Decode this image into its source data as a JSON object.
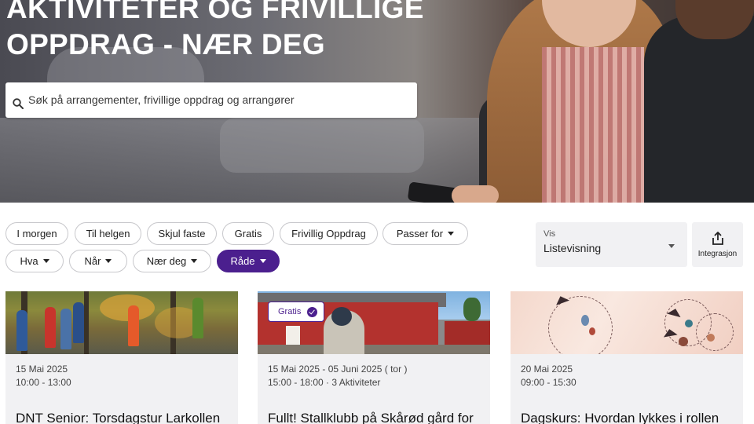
{
  "hero": {
    "title_line1": "AKTIVITETER OG FRIVILLIGE",
    "title_line2": "OPPDRAG - NÆR DEG"
  },
  "search": {
    "placeholder": "Søk på arrangementer, frivillige oppdrag og arrangører",
    "icon": "search-icon"
  },
  "filters": [
    {
      "label": "I morgen",
      "dropdown": false,
      "active": false
    },
    {
      "label": "Til helgen",
      "dropdown": false,
      "active": false
    },
    {
      "label": "Skjul faste",
      "dropdown": false,
      "active": false
    },
    {
      "label": "Gratis",
      "dropdown": false,
      "active": false
    },
    {
      "label": "Frivillig Oppdrag",
      "dropdown": false,
      "active": false
    },
    {
      "label": "Passer for",
      "dropdown": true,
      "active": false
    },
    {
      "label": "Hva",
      "dropdown": true,
      "active": false
    },
    {
      "label": "Når",
      "dropdown": true,
      "active": false
    },
    {
      "label": "Nær deg",
      "dropdown": true,
      "active": false
    },
    {
      "label": "Råde",
      "dropdown": true,
      "active": true
    }
  ],
  "view": {
    "label": "Vis",
    "value": "Listevisning"
  },
  "integration": {
    "label": "Integrasjon",
    "icon": "share-icon"
  },
  "colors": {
    "accent": "#4b1f8e",
    "card_bg": "#f1f1f3"
  },
  "cards": [
    {
      "date": "15 Mai 2025",
      "time": "10:00 - 13:00",
      "title": "DNT Senior: Torsdagstur Larkollen"
    },
    {
      "badge": "Gratis",
      "date": "15 Mai 2025 - 05 Juni 2025 ( tor )",
      "time": "15:00 - 18:00 · 3 Aktiviteter",
      "title": "Fullt! Stallklubb på Skårød gård for"
    },
    {
      "date": "20 Mai 2025",
      "time": "09:00 - 15:30",
      "title": "Dagskurs: Hvordan lykkes i rollen"
    }
  ]
}
